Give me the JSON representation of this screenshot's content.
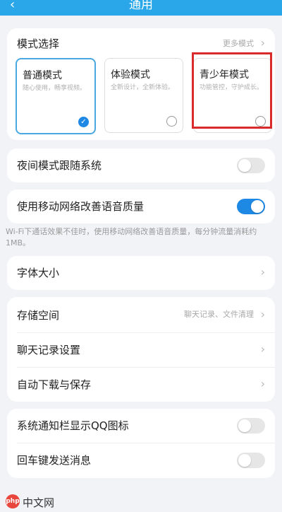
{
  "header": {
    "title": "通用",
    "back_icon": "chevron-left-icon"
  },
  "mode_section": {
    "title": "模式选择",
    "more_label": "更多模式",
    "modes": [
      {
        "title": "普通模式",
        "desc": "随心使用，畅享视频。",
        "selected": true
      },
      {
        "title": "体验模式",
        "desc": "全新设计，全新体验。",
        "selected": false
      },
      {
        "title": "青少年模式",
        "desc": "功能管控，守护成长。",
        "selected": false
      }
    ]
  },
  "night_mode": {
    "label": "夜间模式跟随系统",
    "enabled": false
  },
  "mobile_voice": {
    "label": "使用移动网络改善语音质量",
    "enabled": true,
    "note": "Wi-Fi下通话效果不佳时，使用移动网络改善语音质量，每分钟流量消耗约1MB。"
  },
  "font_size": {
    "label": "字体大小"
  },
  "storage": {
    "items": [
      {
        "label": "存储空间",
        "hint": "聊天记录、文件清理"
      },
      {
        "label": "聊天记录设置",
        "hint": ""
      },
      {
        "label": "自动下载与保存",
        "hint": ""
      }
    ]
  },
  "toggles": {
    "items": [
      {
        "label": "系统通知栏显示QQ图标",
        "enabled": false
      },
      {
        "label": "回车键发送消息",
        "enabled": false
      }
    ]
  },
  "watermark": {
    "logo": "php",
    "text": "中文网"
  },
  "colors": {
    "accent": "#1e88e5",
    "header": "#2aa7e9",
    "highlight": "#d92b2b"
  }
}
